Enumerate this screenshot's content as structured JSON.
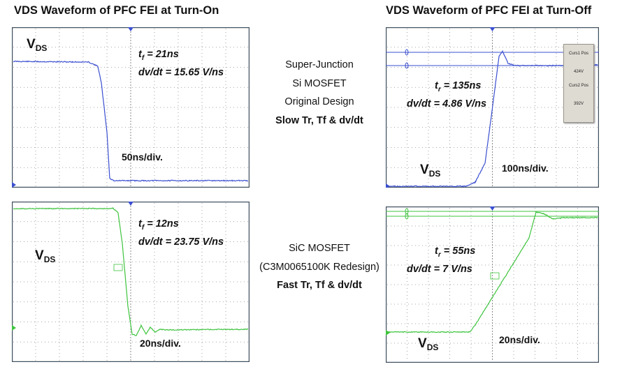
{
  "titles": {
    "left": "VDS Waveform of PFC FEI at Turn-On",
    "right": "VDS Waveform of PFC FEI at Turn-Off"
  },
  "center": {
    "top": [
      "Super-Junction",
      "Si MOSFET",
      "Original Design"
    ],
    "top_bold": "Slow Tr, Tf & dv/dt",
    "bottom": [
      "SiC MOSFET",
      "(C3M0065100K Redesign)"
    ],
    "bottom_bold": "Fast Tr, Tf & dv/dt"
  },
  "panels": [
    {
      "id": "si-on",
      "vds": "V",
      "vds_sub": "DS",
      "t_sym": "t",
      "t_sub": "f",
      "t_val": "= 21ns",
      "dvdt": "dv/dt = 15.65 V/ns",
      "div": "50ns/div."
    },
    {
      "id": "si-off",
      "vds": "V",
      "vds_sub": "DS",
      "t_sym": "t",
      "t_sub": "r",
      "t_val": "= 135ns",
      "dvdt": "dv/dt = 4.86 V/ns",
      "div": "100ns/div."
    },
    {
      "id": "sic-on",
      "vds": "V",
      "vds_sub": "DS",
      "t_sym": "t",
      "t_sub": "f",
      "t_val": "= 12ns",
      "dvdt": "dv/dt = 23.75 V/ns",
      "div": "20ns/div."
    },
    {
      "id": "sic-off",
      "vds": "V",
      "vds_sub": "DS",
      "t_sym": "t",
      "t_sub": "r",
      "t_val": "= 55ns",
      "dvdt": "dv/dt = 7 V/ns",
      "div": "20ns/div."
    }
  ],
  "cursor_box": {
    "line1": "Curs1 Pos",
    "val1": "424V",
    "line2": "Curs2 Pos",
    "val2": "392V"
  },
  "colors": {
    "si_trace": "#3a4fd0",
    "sic_trace": "#3ec43e",
    "grid": "#8a8a8a",
    "frame": "#3d4d5c"
  },
  "chart_data": [
    {
      "type": "line",
      "title": "VDS Waveform of PFC FEI at Turn-On",
      "series": [
        {
          "values": [
            1,
            1,
            1,
            0.95,
            0,
            0,
            0
          ]
        }
      ],
      "annotation": "tf = 21ns, dv/dt = 15.65 V/ns",
      "x_scale": "50ns/div.",
      "grid": true
    },
    {
      "type": "line",
      "title": "VDS Waveform of PFC FEI at Turn-Off",
      "series": [
        {
          "values": [
            0,
            0,
            0.05,
            1,
            1,
            1
          ]
        }
      ],
      "annotation": "tr = 135ns, dv/dt = 4.86 V/ns",
      "x_scale": "100ns/div.",
      "grid": true
    },
    {
      "type": "line",
      "series": [
        {
          "values": [
            1,
            1,
            1,
            0,
            0,
            0
          ]
        }
      ],
      "annotation": "tf = 12ns, dv/dt = 23.75 V/ns",
      "x_scale": "20ns/div.",
      "grid": true
    },
    {
      "type": "line",
      "series": [
        {
          "values": [
            0,
            0,
            0,
            1,
            1,
            1
          ]
        }
      ],
      "annotation": "tr = 55ns, dv/dt = 7 V/ns",
      "x_scale": "20ns/div.",
      "grid": true
    }
  ]
}
